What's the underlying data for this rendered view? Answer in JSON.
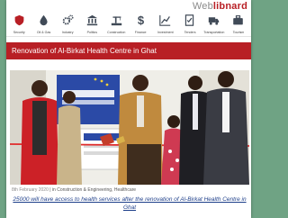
{
  "site": {
    "logo_prefix": "Web",
    "logo_suffix": "libnard"
  },
  "nav": {
    "items": [
      {
        "label": "Security",
        "icon": "shield-icon"
      },
      {
        "label": "Oil & Gas",
        "icon": "oil-drop-icon"
      },
      {
        "label": "Industry",
        "icon": "gears-icon"
      },
      {
        "label": "Politics",
        "icon": "government-building-icon"
      },
      {
        "label": "Construction",
        "icon": "construction-icon"
      },
      {
        "label": "Finance",
        "icon": "dollar-icon"
      },
      {
        "label": "Investment",
        "icon": "trend-chart-icon"
      },
      {
        "label": "Tenders",
        "icon": "tender-document-icon"
      },
      {
        "label": "Transportation",
        "icon": "truck-icon"
      },
      {
        "label": "Tourism",
        "icon": "suitcase-icon"
      }
    ]
  },
  "article": {
    "title": "Renovation of Al-Birkat Health Centre in Ghat",
    "date": "8th February 2020",
    "meta_prefix": " | in ",
    "categories": "Construction & Engineering, Healthcare",
    "caption": "25000 will have access to health services after the renovation of Al-Birkat Health Centre in Ghat"
  },
  "colors": {
    "brand_red": "#b81f25",
    "caption_blue": "#1e3f8a",
    "background_green": "#6fa384"
  }
}
